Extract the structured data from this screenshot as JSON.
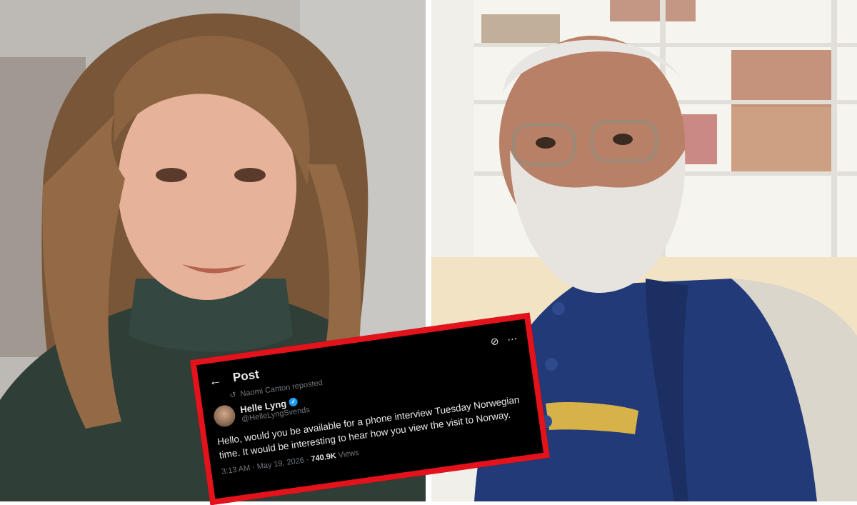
{
  "tweet": {
    "header_title": "Post",
    "reposted_by": "Naomi Canton reposted",
    "author_name": "Helle Lyng",
    "author_handle": "@HelleLyngSvends",
    "body": "Hello, would you be available for a phone interview Tuesday Norwegian time. It would be interesting to hear how you view the visit to Norway.",
    "time": "3:13 AM · May 19, 2026 · ",
    "views_count": "740.9K",
    "views_label": " Views"
  },
  "icons": {
    "back": "back-arrow-icon",
    "grok": "grok-icon",
    "more": "more-icon",
    "repost": "repost-icon",
    "verified": "verified-badge-icon"
  },
  "colors": {
    "frame": "#e4121a",
    "tweet_bg": "#000000",
    "verified": "#1d9bf0",
    "muted": "#71767b"
  }
}
